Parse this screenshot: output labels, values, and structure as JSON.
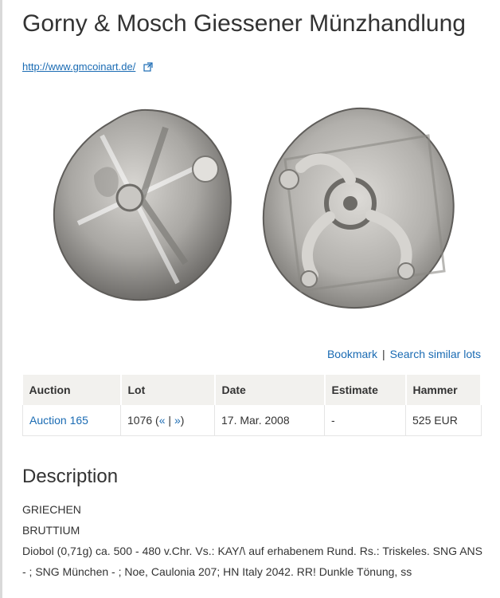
{
  "page": {
    "title": "Gorny & Mosch Giessener Münzhandlung",
    "url": "http://www.gmcoinart.de/"
  },
  "coin_images": {
    "obverse_alt": "coin obverse",
    "reverse_alt": "coin reverse"
  },
  "actions": {
    "bookmark_label": "Bookmark",
    "separator": "|",
    "search_similar_label": "Search similar lots"
  },
  "table": {
    "headers": [
      "Auction",
      "Lot",
      "Date",
      "Estimate",
      "Hammer"
    ],
    "row": {
      "auction": "Auction 165",
      "lot_number": "1076",
      "lot_nav_open": "(",
      "prev": "«",
      "nav_sep": "|",
      "next": "»",
      "lot_nav_close": ")",
      "date": "17. Mar. 2008",
      "estimate": "-",
      "hammer": "525 EUR"
    }
  },
  "description": {
    "heading": "Description",
    "line1": "GRIECHEN",
    "line2": "BRUTTIUM",
    "body": "Diobol (0,71g) ca. 500 - 480 v.Chr. Vs.: KAY/\\ auf erhabenem Rund. Rs.: Triskeles. SNG ANS - ; SNG München - ; Noe, Caulonia 207; HN Italy 2042. RR! Dunkle Tönung, ss"
  },
  "colors": {
    "link": "#1a6bb3",
    "header_bg": "#f2f1ee",
    "text": "#333333"
  },
  "icons": [
    "external-link-icon"
  ]
}
